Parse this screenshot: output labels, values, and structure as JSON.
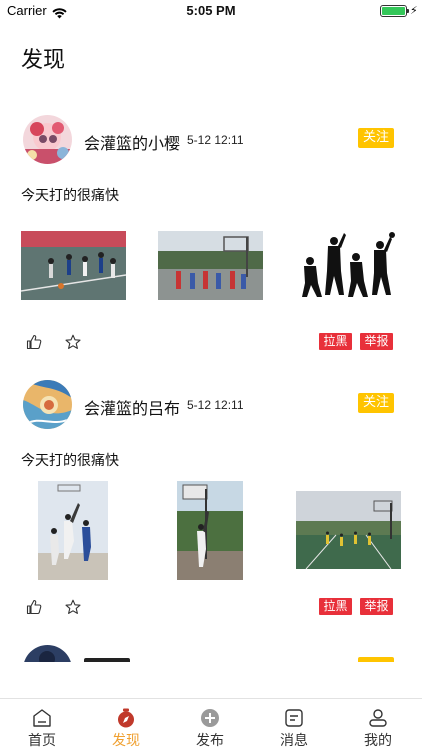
{
  "status_bar": {
    "carrier": "Carrier",
    "time": "5:05 PM",
    "battery_level": 1.0
  },
  "page": {
    "title": "发现"
  },
  "posts": [
    {
      "username": "会灌篮的小樱",
      "timestamp": "5-12 12:11",
      "follow_label": "关注",
      "text": "今天打的很痛快",
      "block_label": "拉黑",
      "report_label": "举报"
    },
    {
      "username": "会灌篮的吕布",
      "timestamp": "5-12 12:11",
      "follow_label": "关注",
      "text": "今天打的很痛快",
      "block_label": "拉黑",
      "report_label": "举报"
    }
  ],
  "tab_bar": {
    "items": [
      {
        "label": "首页",
        "icon": "home-icon"
      },
      {
        "label": "发现",
        "icon": "discover-icon"
      },
      {
        "label": "发布",
        "icon": "publish-icon"
      },
      {
        "label": "消息",
        "icon": "message-icon"
      },
      {
        "label": "我的",
        "icon": "profile-icon"
      }
    ],
    "active_index": 1
  },
  "colors": {
    "follow_button": "#ffc400",
    "tag_button": "#e8303a",
    "active_tab": "#f0a030",
    "inactive_tab": "#333333"
  }
}
